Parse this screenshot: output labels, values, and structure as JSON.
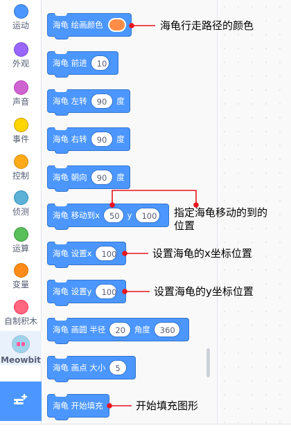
{
  "categories": [
    {
      "label": "运动",
      "color": "#4c97ff"
    },
    {
      "label": "外观",
      "color": "#9966ff"
    },
    {
      "label": "声音",
      "color": "#cf63cf"
    },
    {
      "label": "事件",
      "color": "#ffd500"
    },
    {
      "label": "控制",
      "color": "#ffab19"
    },
    {
      "label": "侦测",
      "color": "#5cb1d6"
    },
    {
      "label": "运算",
      "color": "#59c059"
    },
    {
      "label": "变量",
      "color": "#ff8c1a"
    },
    {
      "label": "自制积木",
      "color": "#ff6680"
    }
  ],
  "extension": {
    "label": "Meowbit",
    "icon": "meowbit-face-icon"
  },
  "add_extension_icon": "add-extension-icon",
  "blocks": {
    "pen_color": {
      "text": "海龟 绘画颜色",
      "color": "#ff8c47"
    },
    "forward": {
      "text": "海龟 前进",
      "value": "10"
    },
    "left": {
      "text": "海龟 左转",
      "value": "90",
      "unit": "度"
    },
    "right": {
      "text": "海龟 右转",
      "value": "90",
      "unit": "度"
    },
    "heading": {
      "text": "海龟 朝向",
      "value": "90",
      "unit": "度"
    },
    "goto": {
      "text": "海龟 移动到x",
      "x": "50",
      "y_label": "y",
      "y": "100"
    },
    "set_x": {
      "text": "海龟 设置x",
      "value": "100"
    },
    "set_y": {
      "text": "海龟 设置y",
      "value": "100"
    },
    "circle": {
      "text": "海龟 画圆 半径",
      "radius": "20",
      "angle_label": "角度",
      "angle": "360"
    },
    "dot": {
      "text": "海龟 画点 大小",
      "value": "5"
    },
    "begin_fill": {
      "text": "海龟 开始填充"
    }
  },
  "annotations": {
    "pen_color": "海龟行走路径的颜色",
    "goto_line1": "指定海龟移动的到的",
    "goto_line2": "位置",
    "set_x": "设置海龟的x坐标位置",
    "set_y": "设置海龟的y坐标位置",
    "begin_fill": "开始填充图形"
  },
  "annotation_color": "#e8141c"
}
